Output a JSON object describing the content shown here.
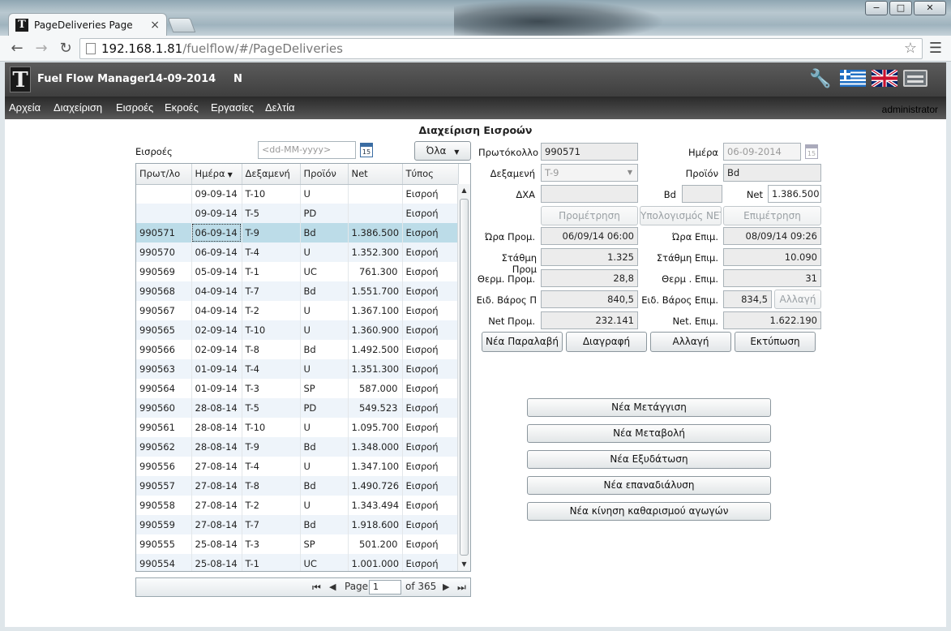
{
  "browser": {
    "tab_title": "PageDeliveries Page",
    "tab_close": "×",
    "favicon": "T",
    "url_host": "192.168.1.81",
    "url_path": "/fuelflow/#/PageDeliveries",
    "window_controls": [
      "−",
      "□",
      "✕"
    ]
  },
  "app": {
    "logo": "T",
    "title": "Fuel Flow Manager",
    "date": "14-09-2014",
    "mode": "N",
    "menu": [
      "Αρχεία",
      "Διαχείριση",
      "Εισροές",
      "Εκροές",
      "Εργασίες",
      "Δελτία"
    ],
    "user": "administrator",
    "page_title": "Διαχείριση Εισροών"
  },
  "list": {
    "label": "Εισροές",
    "date_placeholder": "<dd-MM-yyyy>",
    "calendar_day": "15",
    "filter_value": "Όλα",
    "columns": [
      "Πρωτ/λο",
      "Ημέρα",
      "Δεξαμενή",
      "Προϊόν",
      "Net",
      "Τύπος"
    ],
    "rows": [
      [
        "",
        "09-09-14",
        "T-10",
        "U",
        "",
        "Εισροή"
      ],
      [
        "",
        "09-09-14",
        "T-5",
        "PD",
        "",
        "Εισροή"
      ],
      [
        "990571",
        "06-09-14",
        "T-9",
        "Bd",
        "1.386.500",
        "Εισροή"
      ],
      [
        "990570",
        "06-09-14",
        "T-4",
        "U",
        "1.352.300",
        "Εισροή"
      ],
      [
        "990569",
        "05-09-14",
        "T-1",
        "UC",
        "761.300",
        "Εισροή"
      ],
      [
        "990568",
        "04-09-14",
        "T-7",
        "Bd",
        "1.551.700",
        "Εισροή"
      ],
      [
        "990567",
        "04-09-14",
        "T-2",
        "U",
        "1.367.100",
        "Εισροή"
      ],
      [
        "990565",
        "02-09-14",
        "T-10",
        "U",
        "1.360.900",
        "Εισροή"
      ],
      [
        "990566",
        "02-09-14",
        "T-8",
        "Bd",
        "1.492.500",
        "Εισροή"
      ],
      [
        "990563",
        "01-09-14",
        "T-4",
        "U",
        "1.351.300",
        "Εισροή"
      ],
      [
        "990564",
        "01-09-14",
        "T-3",
        "SP",
        "587.000",
        "Εισροή"
      ],
      [
        "990560",
        "28-08-14",
        "T-5",
        "PD",
        "549.523",
        "Εισροή"
      ],
      [
        "990561",
        "28-08-14",
        "T-10",
        "U",
        "1.095.700",
        "Εισροή"
      ],
      [
        "990562",
        "28-08-14",
        "T-9",
        "Bd",
        "1.348.000",
        "Εισροή"
      ],
      [
        "990556",
        "27-08-14",
        "T-4",
        "U",
        "1.347.100",
        "Εισροή"
      ],
      [
        "990557",
        "27-08-14",
        "T-8",
        "Bd",
        "1.490.726",
        "Εισροή"
      ],
      [
        "990558",
        "27-08-14",
        "T-2",
        "U",
        "1.343.494",
        "Εισροή"
      ],
      [
        "990559",
        "27-08-14",
        "T-7",
        "Bd",
        "1.918.600",
        "Εισροή"
      ],
      [
        "990555",
        "25-08-14",
        "T-3",
        "SP",
        "501.200",
        "Εισροή"
      ],
      [
        "990554",
        "25-08-14",
        "T-1",
        "UC",
        "1.001.000",
        "Εισροή"
      ]
    ],
    "selected_row": 2,
    "pager": {
      "page_label": "Page",
      "page_value": "1",
      "of_label": "of 365"
    }
  },
  "form": {
    "protocol_label": "Πρωτόκολλο",
    "protocol_value": "990571",
    "day_label": "Ημέρα",
    "day_value": "06-09-2014",
    "tank_label": "Δεξαμενή",
    "tank_value": "T-9",
    "product_label": "Προϊόν",
    "product_value": "Bd",
    "dxa_label": "ΔΧΑ",
    "dxa_value": "",
    "bd_label": "Bd",
    "bd_value": "",
    "net_label": "Net",
    "net_value": "1.386.500",
    "btn_premeasure": "Προμέτρηση",
    "btn_calc_net": "Υπολογισμός NET",
    "btn_remeasure": "Επιμέτρηση",
    "time_pre_label": "Ώρα Προμ.",
    "time_pre_value": "06/09/14 06:00",
    "time_post_label": "Ώρα Επιμ.",
    "time_post_value": "08/09/14 09:26",
    "level_pre_label": "Στάθμη Προμ",
    "level_pre_value": "1.325",
    "level_post_label": "Στάθμη Επιμ.",
    "level_post_value": "10.090",
    "temp_pre_label": "Θερμ. Προμ.",
    "temp_pre_value": "28,8",
    "temp_post_label": "Θερμ . Επιμ.",
    "temp_post_value": "31",
    "density_pre_label": "Ειδ. Βάρος Π",
    "density_pre_value": "840,5",
    "density_post_label": "Ειδ. Βάρος Επιμ.",
    "density_post_value": "834,5",
    "btn_change_small": "Αλλαγή",
    "net_pre_label": "Net Προμ.",
    "net_pre_value": "232.141",
    "net_post_label": "Net. Επιμ.",
    "net_post_value": "1.622.190",
    "btn_new_receipt": "Νέα Παραλαβή",
    "btn_delete": "Διαγραφή",
    "btn_change": "Αλλαγή",
    "btn_print": "Εκτύπωση"
  },
  "actions": [
    "Νέα Μετάγγιση",
    "Νέα Μεταβολή",
    "Νέα Εξυδάτωση",
    "Νέα επαναδιάλυση",
    "Νέα κίνηση καθαρισμού αγωγών"
  ]
}
